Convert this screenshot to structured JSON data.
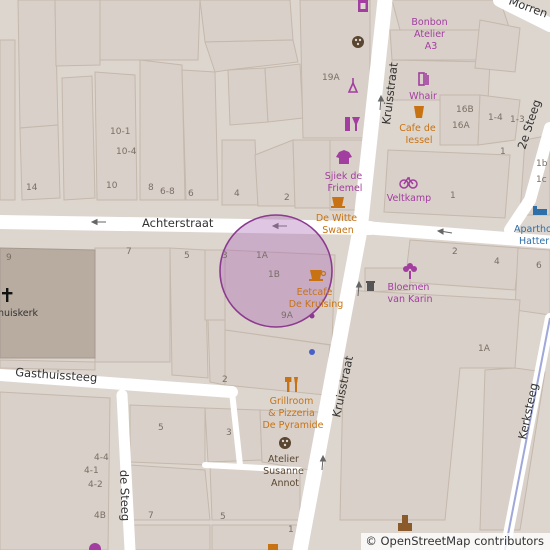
{
  "streets": {
    "achterstraat": "Achterstraat",
    "kruisstraat_top": "Kruisstraat",
    "kruisstraat_bottom": "Kruisstraat",
    "gasthuissteeg": "Gasthuissteeg",
    "de_steeg": "de Steeg",
    "second_steeg": "2e Steeg",
    "kerksteeg": "Kerksteeg",
    "morren": "Morren"
  },
  "pois": {
    "bonbon": [
      "Bonbon",
      "Atelier",
      "A3"
    ],
    "whair": [
      "Whair"
    ],
    "cafe_de_lessel": [
      "Cafe de",
      "Iessel"
    ],
    "sjiek": [
      "Sjiek de",
      "Friemel"
    ],
    "veltkamp": [
      "Veltkamp"
    ],
    "de_witte_swaen": [
      "De Witte",
      "Swaen"
    ],
    "aparthotel": [
      "Apartho",
      "Hatter"
    ],
    "eetcafe": [
      "Eetcafe",
      "De Kruising"
    ],
    "bloemen": [
      "Bloemen",
      "van Karin"
    ],
    "grillroom": [
      "Grillroom",
      "& Pizzeria",
      "De Pyramide"
    ],
    "atelier_susanne": [
      "Atelier",
      "Susanne",
      "Annot"
    ],
    "church": [
      "Gasthuiskerk"
    ]
  },
  "house_numbers": {
    "n19A": "19A",
    "n16B": "16B",
    "n16A": "16A",
    "n1_4": "1-4",
    "n1_3": "1-3",
    "n1": "1",
    "n1b": "1b",
    "n1c": "1c",
    "n10_1": "10-1",
    "n10_4": "10-4",
    "n14": "14",
    "n10": "10",
    "n8": "8",
    "n6_8": "6-8",
    "n6": "6",
    "n4": "4",
    "n2": "2",
    "n1_vk": "1",
    "n9": "9",
    "n7": "7",
    "n5": "5",
    "n3": "3",
    "n1A": "1A",
    "n1B": "1B",
    "n9A": "9A",
    "n2_kr": "2",
    "n4_kr": "4",
    "n6_kr": "6",
    "n1A_right": "1A",
    "n2_gs": "2",
    "n5_s": "5",
    "n3_s": "3",
    "n4_4": "4-4",
    "n4_1": "4-1",
    "n4_2": "4-2",
    "n4B": "4B",
    "n7_s": "7",
    "n5_b": "5",
    "n1_s": "1"
  },
  "attribution": {
    "symbol": "©",
    "text": "OpenStreetMap contributors"
  },
  "colors": {
    "background": "#ddd6cf",
    "building": "#d9d0c9",
    "building_stroke": "#c5b8ac",
    "church": "#b8aba0",
    "road": "#ffffff",
    "shop_poi": "#a23ea0",
    "food_poi": "#c77314",
    "info_poi": "#2f6fa7",
    "highlight_fill": "#b070b8",
    "highlight_stroke": "#8b3a8f",
    "point": "#4a60c8"
  },
  "icons": {
    "bakery": "cake-icon",
    "art": "palette-icon",
    "hair": "hairdresser-icon",
    "cafe": "cup-icon",
    "wine": "wine-icon",
    "clothes": "shirt-icon",
    "bicycle": "bicycle-icon",
    "coffee": "coffee-icon",
    "hotel": "bed-icon",
    "florist": "flower-icon",
    "restaurant": "cutlery-icon",
    "church": "cross-icon",
    "oneway": "arrow-icon",
    "waste": "bin-icon"
  }
}
